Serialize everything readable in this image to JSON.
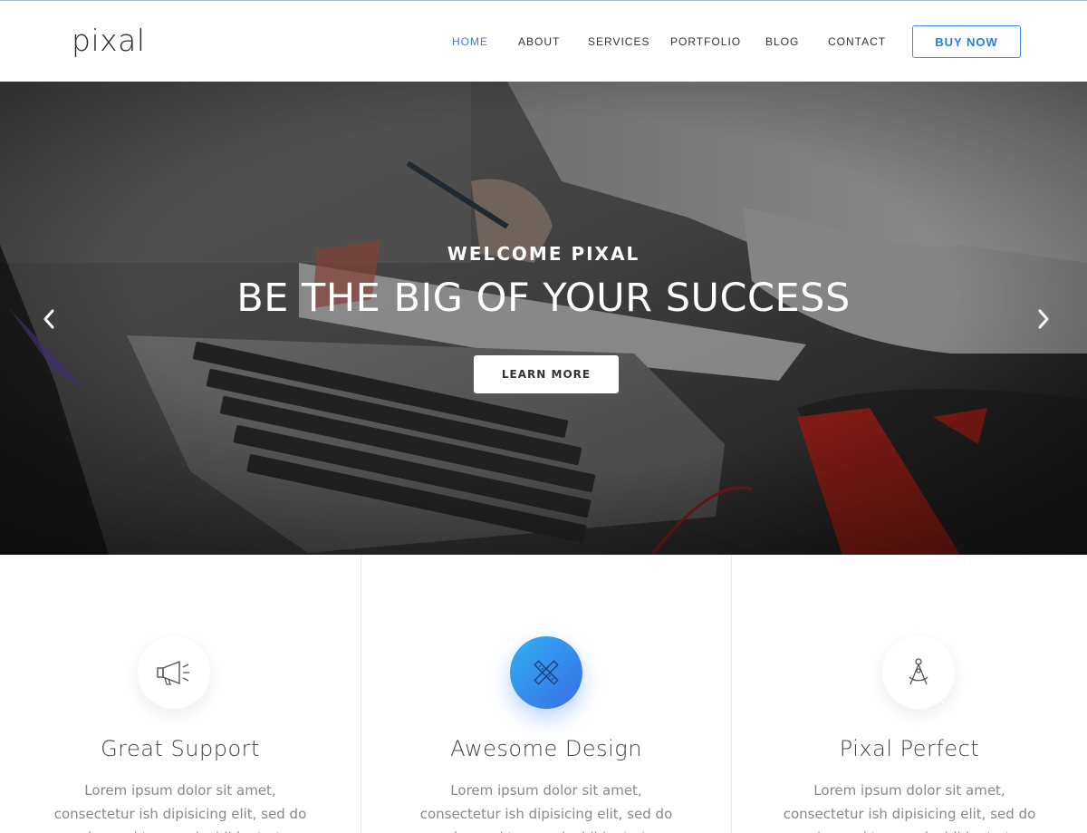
{
  "brand": {
    "logo": "pixal"
  },
  "nav": {
    "items": [
      {
        "label": "HOME",
        "active": true
      },
      {
        "label": "ABOUT",
        "active": false
      },
      {
        "label": "SERVICES",
        "active": false
      },
      {
        "label": "PORTFOLIO",
        "active": false
      },
      {
        "label": "BLOG",
        "active": false
      },
      {
        "label": "CONTACT",
        "active": false
      }
    ],
    "cta_label": "BUY NOW"
  },
  "hero": {
    "kicker": "WELCOME PIXAL",
    "title": "BE THE BIG OF YOUR SUCCESS",
    "button_label": "LEARN MORE",
    "prev_icon": "chevron-left-icon",
    "next_icon": "chevron-right-icon"
  },
  "features": [
    {
      "icon": "megaphone-icon",
      "title": "Great Support",
      "text": "Lorem ipsum dolor sit amet, consectetur ish dipisicing elit, sed do eiusmod tempor incididunt ut"
    },
    {
      "icon": "pencil-ruler-icon",
      "title": "Awesome Design",
      "text": "Lorem ipsum dolor sit amet, consectetur ish dipisicing elit, sed do eiusmod tempor incididunt ut"
    },
    {
      "icon": "compass-icon",
      "title": "Pixal Perfect",
      "text": "Lorem ipsum dolor sit amet, consectetur ish dipisicing elit, sed do eiusmod tempor incididunt ut"
    }
  ],
  "colors": {
    "accent": "#3c7ee0",
    "accent_gradient_start": "#2fb0f4",
    "accent_gradient_end": "#3a6ee6"
  }
}
